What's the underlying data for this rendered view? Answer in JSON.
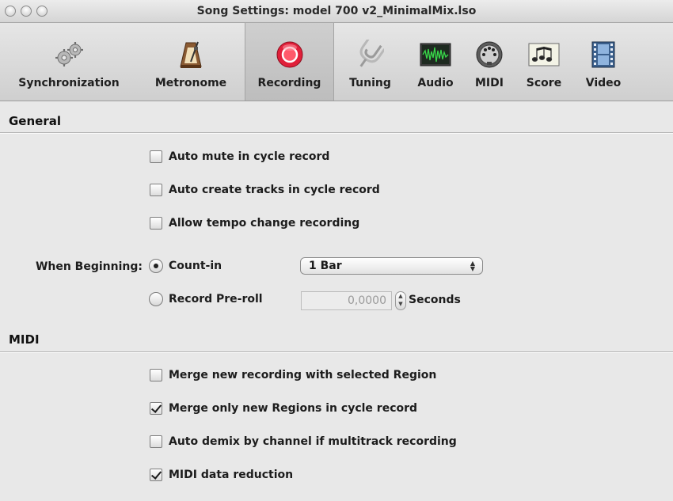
{
  "window": {
    "title": "Song Settings: model 700 v2_MinimalMix.lso"
  },
  "toolbar": {
    "items": [
      {
        "label": "Synchronization",
        "icon": "gears-icon"
      },
      {
        "label": "Metronome",
        "icon": "metronome-icon"
      },
      {
        "label": "Recording",
        "icon": "record-icon"
      },
      {
        "label": "Tuning",
        "icon": "tuning-fork-icon"
      },
      {
        "label": "Audio",
        "icon": "audio-waveform-icon"
      },
      {
        "label": "MIDI",
        "icon": "midi-connector-icon"
      },
      {
        "label": "Score",
        "icon": "music-notes-icon"
      },
      {
        "label": "Video",
        "icon": "film-icon"
      }
    ],
    "selected": "Recording",
    "accent_record": "#e0203a"
  },
  "general": {
    "title": "General",
    "options": [
      {
        "label": "Auto mute in cycle record",
        "checked": false
      },
      {
        "label": "Auto create tracks in cycle record",
        "checked": false
      },
      {
        "label": "Allow tempo change recording",
        "checked": false
      }
    ],
    "when_beginning_label": "When Beginning:",
    "count_in_label": "Count-in",
    "count_in_value": "1 Bar",
    "preroll_label": "Record Pre-roll",
    "preroll_value": "0,0000",
    "preroll_unit": "Seconds",
    "selected_mode": "Count-in"
  },
  "midi": {
    "title": "MIDI",
    "options": [
      {
        "label": "Merge new recording with selected Region",
        "checked": false
      },
      {
        "label": "Merge only new Regions in cycle record",
        "checked": true
      },
      {
        "label": "Auto demix by channel if multitrack recording",
        "checked": false
      },
      {
        "label": "MIDI data reduction",
        "checked": true
      }
    ]
  }
}
